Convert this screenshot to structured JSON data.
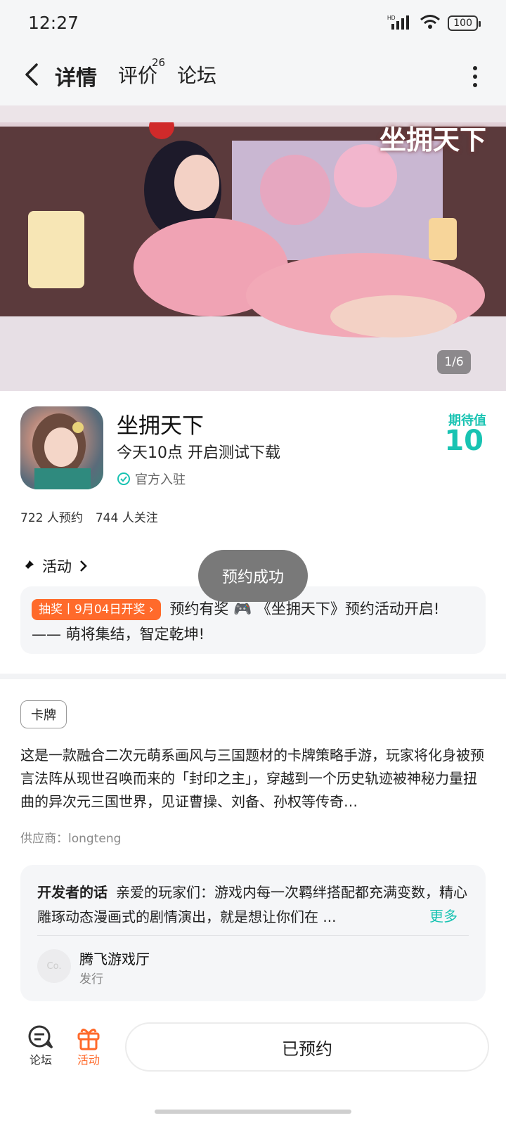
{
  "status_bar": {
    "time": "12:27",
    "battery": "100",
    "network": "HD"
  },
  "nav": {
    "tabs": [
      {
        "label": "详情",
        "active": true
      },
      {
        "label": "评价",
        "badge": "26"
      },
      {
        "label": "论坛"
      }
    ]
  },
  "banner": {
    "logo_text": "坐拥天下",
    "counter": "1/6"
  },
  "game": {
    "name": "坐拥天下",
    "subtitle": "今天10点 开启测试下载",
    "verified_label": "官方入驻",
    "expect_label": "期待值",
    "expect_value": "10",
    "reservations": "722 人预约",
    "followers": "744 人关注"
  },
  "activity": {
    "header": "活动",
    "tag": "抽奖丨9月04日开奖",
    "text_line1": "预约有奖 🎮 《坐拥天下》预约活动开启!",
    "text_line2": "—— 萌将集结，智定乾坤!"
  },
  "toast": "预约成功",
  "detail": {
    "category": "卡牌",
    "description": "这是一款融合二次元萌系画风与三国题材的卡牌策略手游，玩家将化身被预言法阵从现世召唤而来的「封印之主」，穿越到一个历史轨迹被神秘力量扭曲的异次元三国世界，见证曹操、刘备、孙权等传奇…",
    "supplier": "供应商：longteng"
  },
  "developer": {
    "label": "开发者的话",
    "text": "亲爱的玩家们：游戏内每一次羁绊搭配都充满变数，精心雕琢动态漫画式的剧情演出，就是想让你们在 ...",
    "more": "更多",
    "avatar_text": "Co.",
    "name": "腾飞游戏厅",
    "role": "发行"
  },
  "bottom": {
    "forum_label": "论坛",
    "activity_label": "活动",
    "reserved_button": "已预约"
  },
  "colors": {
    "accent": "#18c3b2",
    "orange": "#ff6a2b"
  }
}
